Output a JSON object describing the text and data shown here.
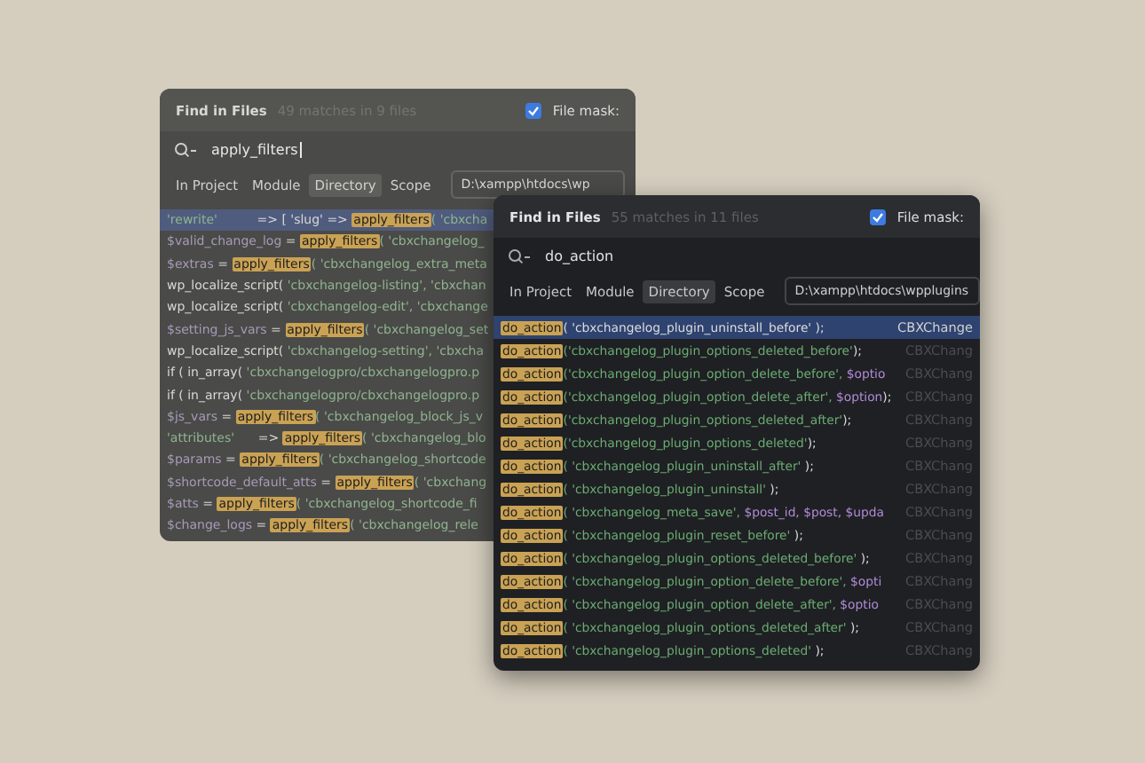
{
  "windows": [
    {
      "title": "Find in Files",
      "summary": "49 matches in 9 files",
      "file_mask": {
        "label": "File mask:",
        "checked": true
      },
      "query": "apply_filters",
      "scopes": [
        {
          "label": "In Project",
          "selected": false
        },
        {
          "label": "Module",
          "selected": false
        },
        {
          "label": "Directory",
          "selected": true
        },
        {
          "label": "Scope",
          "selected": false
        }
      ],
      "path": "D:\\xampp\\htdocs\\wp",
      "results": [
        {
          "selected": true,
          "segments": [
            {
              "text": "'rewrite'",
              "kind": "string"
            },
            {
              "text": "          => [ 'slug' => ",
              "kind": "plain"
            },
            {
              "text": "apply_filters",
              "kind": "match"
            },
            {
              "text": "( 'cbxcha",
              "kind": "string"
            }
          ]
        },
        {
          "selected": false,
          "segments": [
            {
              "text": "$valid_change_log",
              "kind": "var"
            },
            {
              "text": " = ",
              "kind": "plain"
            },
            {
              "text": "apply_filters",
              "kind": "match"
            },
            {
              "text": "( 'cbxchangelog_",
              "kind": "string"
            }
          ]
        },
        {
          "selected": false,
          "segments": [
            {
              "text": "$extras",
              "kind": "var"
            },
            {
              "text": " = ",
              "kind": "plain"
            },
            {
              "text": "apply_filters",
              "kind": "match"
            },
            {
              "text": "( 'cbxchangelog_extra_meta",
              "kind": "string"
            }
          ]
        },
        {
          "selected": false,
          "segments": [
            {
              "text": "wp_localize_script( ",
              "kind": "plain"
            },
            {
              "text": "'cbxchangelog-listing', 'cbxchan",
              "kind": "string"
            }
          ]
        },
        {
          "selected": false,
          "segments": [
            {
              "text": "wp_localize_script( ",
              "kind": "plain"
            },
            {
              "text": "'cbxchangelog-edit', 'cbxchange",
              "kind": "string"
            }
          ]
        },
        {
          "selected": false,
          "segments": [
            {
              "text": "$setting_js_vars",
              "kind": "var"
            },
            {
              "text": " = ",
              "kind": "plain"
            },
            {
              "text": "apply_filters",
              "kind": "match"
            },
            {
              "text": "( 'cbxchangelog_set",
              "kind": "string"
            }
          ]
        },
        {
          "selected": false,
          "segments": [
            {
              "text": "wp_localize_script( ",
              "kind": "plain"
            },
            {
              "text": "'cbxchangelog-setting', 'cbxcha",
              "kind": "string"
            }
          ]
        },
        {
          "selected": false,
          "segments": [
            {
              "text": "if ( in_array( ",
              "kind": "plain"
            },
            {
              "text": "'cbxchangelogpro/cbxchangelogpro.p",
              "kind": "string"
            }
          ]
        },
        {
          "selected": false,
          "segments": [
            {
              "text": "if ( in_array( ",
              "kind": "plain"
            },
            {
              "text": "'cbxchangelogpro/cbxchangelogpro.p",
              "kind": "string"
            }
          ]
        },
        {
          "selected": false,
          "segments": [
            {
              "text": "$js_vars",
              "kind": "var"
            },
            {
              "text": " = ",
              "kind": "plain"
            },
            {
              "text": "apply_filters",
              "kind": "match"
            },
            {
              "text": "( 'cbxchangelog_block_js_v",
              "kind": "string"
            }
          ]
        },
        {
          "selected": false,
          "segments": [
            {
              "text": "'attributes'",
              "kind": "string"
            },
            {
              "text": "      => ",
              "kind": "plain"
            },
            {
              "text": "apply_filters",
              "kind": "match"
            },
            {
              "text": "( 'cbxchangelog_blo",
              "kind": "string"
            }
          ]
        },
        {
          "selected": false,
          "segments": [
            {
              "text": "$params",
              "kind": "var"
            },
            {
              "text": " = ",
              "kind": "plain"
            },
            {
              "text": "apply_filters",
              "kind": "match"
            },
            {
              "text": "( 'cbxchangelog_shortcode",
              "kind": "string"
            }
          ]
        },
        {
          "selected": false,
          "segments": [
            {
              "text": "$shortcode_default_atts",
              "kind": "var"
            },
            {
              "text": " = ",
              "kind": "plain"
            },
            {
              "text": "apply_filters",
              "kind": "match"
            },
            {
              "text": "( 'cbxchang",
              "kind": "string"
            }
          ]
        },
        {
          "selected": false,
          "segments": [
            {
              "text": "$atts",
              "kind": "var"
            },
            {
              "text": " = ",
              "kind": "plain"
            },
            {
              "text": "apply_filters",
              "kind": "match"
            },
            {
              "text": "( 'cbxchangelog_shortcode_fi",
              "kind": "string"
            }
          ]
        },
        {
          "selected": false,
          "segments": [
            {
              "text": "$change_logs",
              "kind": "var"
            },
            {
              "text": " = ",
              "kind": "plain"
            },
            {
              "text": "apply_filters",
              "kind": "match"
            },
            {
              "text": "( 'cbxchangelog_rele",
              "kind": "string"
            }
          ]
        }
      ]
    },
    {
      "title": "Find in Files",
      "summary": "55 matches in 11 files",
      "file_mask": {
        "label": "File mask:",
        "checked": true
      },
      "query": "do_action",
      "scopes": [
        {
          "label": "In Project",
          "selected": false
        },
        {
          "label": "Module",
          "selected": false
        },
        {
          "label": "Directory",
          "selected": true
        },
        {
          "label": "Scope",
          "selected": false
        }
      ],
      "path": "D:\\xampp\\htdocs\\wpplugins",
      "results": [
        {
          "selected": true,
          "file": "CBXChange",
          "segments": [
            {
              "text": "do_action",
              "kind": "match"
            },
            {
              "text": "( 'cbxchangelog_plugin_uninstall_before' );",
              "kind": "plain"
            }
          ]
        },
        {
          "selected": false,
          "file": "CBXChang",
          "segments": [
            {
              "text": "do_action",
              "kind": "match"
            },
            {
              "text": "('cbxchangelog_plugin_options_deleted_before'",
              "kind": "string"
            },
            {
              "text": ");",
              "kind": "plain"
            }
          ]
        },
        {
          "selected": false,
          "file": "CBXChang",
          "segments": [
            {
              "text": "do_action",
              "kind": "match"
            },
            {
              "text": "('cbxchangelog_plugin_option_delete_before', ",
              "kind": "string"
            },
            {
              "text": "$optio",
              "kind": "var"
            }
          ]
        },
        {
          "selected": false,
          "file": "CBXChang",
          "segments": [
            {
              "text": "do_action",
              "kind": "match"
            },
            {
              "text": "('cbxchangelog_plugin_option_delete_after', ",
              "kind": "string"
            },
            {
              "text": "$option",
              "kind": "var"
            },
            {
              "text": ");",
              "kind": "plain"
            }
          ]
        },
        {
          "selected": false,
          "file": "CBXChang",
          "segments": [
            {
              "text": "do_action",
              "kind": "match"
            },
            {
              "text": "('cbxchangelog_plugin_options_deleted_after'",
              "kind": "string"
            },
            {
              "text": ");",
              "kind": "plain"
            }
          ]
        },
        {
          "selected": false,
          "file": "CBXChang",
          "segments": [
            {
              "text": "do_action",
              "kind": "match"
            },
            {
              "text": "('cbxchangelog_plugin_options_deleted'",
              "kind": "string"
            },
            {
              "text": ");",
              "kind": "plain"
            }
          ]
        },
        {
          "selected": false,
          "file": "CBXChang",
          "segments": [
            {
              "text": "do_action",
              "kind": "match"
            },
            {
              "text": "( 'cbxchangelog_plugin_uninstall_after'",
              "kind": "string"
            },
            {
              "text": " );",
              "kind": "plain"
            }
          ]
        },
        {
          "selected": false,
          "file": "CBXChang",
          "segments": [
            {
              "text": "do_action",
              "kind": "match"
            },
            {
              "text": "( 'cbxchangelog_plugin_uninstall'",
              "kind": "string"
            },
            {
              "text": " );",
              "kind": "plain"
            }
          ]
        },
        {
          "selected": false,
          "file": "CBXChang",
          "segments": [
            {
              "text": "do_action",
              "kind": "match"
            },
            {
              "text": "( 'cbxchangelog_meta_save', ",
              "kind": "string"
            },
            {
              "text": "$post_id, $post, $upda",
              "kind": "var"
            }
          ]
        },
        {
          "selected": false,
          "file": "CBXChang",
          "segments": [
            {
              "text": "do_action",
              "kind": "match"
            },
            {
              "text": "( 'cbxchangelog_plugin_reset_before'",
              "kind": "string"
            },
            {
              "text": " );",
              "kind": "plain"
            }
          ]
        },
        {
          "selected": false,
          "file": "CBXChang",
          "segments": [
            {
              "text": "do_action",
              "kind": "match"
            },
            {
              "text": "( 'cbxchangelog_plugin_options_deleted_before'",
              "kind": "string"
            },
            {
              "text": " );",
              "kind": "plain"
            }
          ]
        },
        {
          "selected": false,
          "file": "CBXChang",
          "segments": [
            {
              "text": "do_action",
              "kind": "match"
            },
            {
              "text": "( 'cbxchangelog_plugin_option_delete_before', ",
              "kind": "string"
            },
            {
              "text": "$opti",
              "kind": "var"
            }
          ]
        },
        {
          "selected": false,
          "file": "CBXChang",
          "segments": [
            {
              "text": "do_action",
              "kind": "match"
            },
            {
              "text": "( 'cbxchangelog_plugin_option_delete_after', ",
              "kind": "string"
            },
            {
              "text": "$optio",
              "kind": "var"
            }
          ]
        },
        {
          "selected": false,
          "file": "CBXChang",
          "segments": [
            {
              "text": "do_action",
              "kind": "match"
            },
            {
              "text": "( 'cbxchangelog_plugin_options_deleted_after'",
              "kind": "string"
            },
            {
              "text": " );",
              "kind": "plain"
            }
          ]
        },
        {
          "selected": false,
          "file": "CBXChang",
          "segments": [
            {
              "text": "do_action",
              "kind": "match"
            },
            {
              "text": "( 'cbxchangelog_plugin_options_deleted'",
              "kind": "string"
            },
            {
              "text": " );",
              "kind": "plain"
            }
          ]
        }
      ]
    }
  ]
}
